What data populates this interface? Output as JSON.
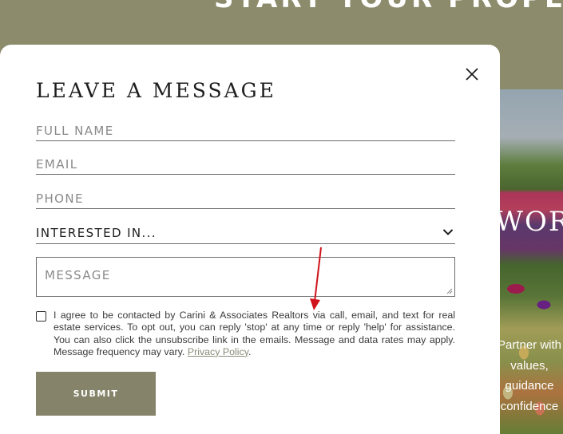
{
  "background": {
    "hero_heading": "START YOUR PROPERTY",
    "photo_heading": "WORK",
    "photo_lines": [
      "Partner with",
      "values,",
      "guidance",
      "confidence"
    ]
  },
  "modal": {
    "title": "LEAVE A MESSAGE",
    "close_icon": "close-icon",
    "fields": {
      "full_name": {
        "placeholder": "FULL NAME",
        "value": ""
      },
      "email": {
        "placeholder": "EMAIL",
        "value": ""
      },
      "phone": {
        "placeholder": "PHONE",
        "value": ""
      },
      "interested_in": {
        "selected": "INTERESTED IN...",
        "icon": "chevron-down-icon"
      },
      "message": {
        "placeholder": "MESSAGE",
        "value": ""
      }
    },
    "consent": {
      "checked": false,
      "text": "I agree to be contacted by Carini & Associates Realtors via call, email, and text for real estate services. To opt out, you can reply 'stop' at any time or reply 'help' for assistance. You can also click the unsubscribe link in the emails. Message and data rates may apply. Message frequency may vary.",
      "link_label": "Privacy Policy",
      "trailing": "."
    },
    "submit_label": "SUBMIT"
  },
  "colors": {
    "accent_olive": "#85846a",
    "band_olive": "#8c8b6c",
    "annotation_red": "#d0121b"
  }
}
